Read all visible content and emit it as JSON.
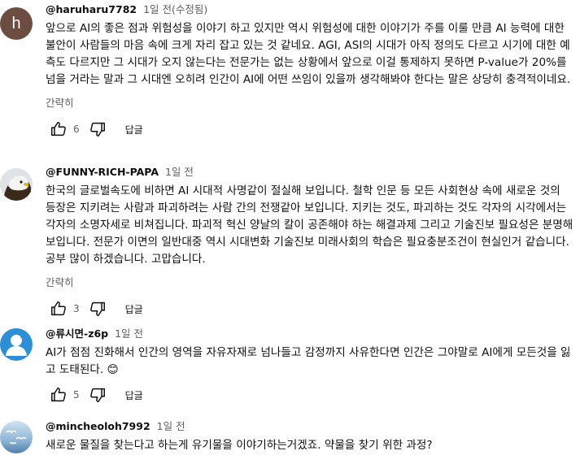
{
  "comments": [
    {
      "author": "@haruharu7782",
      "time": "1일 전(수정됨)",
      "avatar_letter": "h",
      "text": "앞으로 AI의 좋은 점과 위험성을 이야기 하고 있지만 역시 위험성에 대한 이야기가 주를 이룰 만큼 AI 능력에 대한 불안이 사람들의 마음 속에 크게 자리 잡고 있는 것 같네요. AGI, ASI의 시대가 아직 정의도 다르고 시기에 대한 예측도 다르지만 그 시대가 오지 않는다는 전문가는 없는 상황에서 앞으로 이걸 통제하지 못하면 P-value가 20%를 넘을 거라는 말과 그 시대엔 오히려 인간이 AI에 어떤 쓰임이 있을까 생각해봐야 한다는 말은 상당히 충격적이네요.",
      "more": "간략히",
      "likes": "6",
      "reply": "답글"
    },
    {
      "author": "@FUNNY-RICH-PAPA",
      "time": "1일 전",
      "text": "한국의 글로벌속도에 비하면 AI 시대적 사명같이 절실해 보입니다. 철학 인문 등 모든 사회현상 속에 새로운 것의 등장은 지키려는 사람과 파괴하려는 사람 간의 전쟁같아 보입니다. 지키는 것도, 파괴하는 것도 각자의 시각에서는 각자의 소명자세로 비쳐집니다. 파괴적 혁신 양날의 칼이 공존해야 하는 해결과제 그리고 기술진보 필요성은 분명해 보입니다. 전문가 이면의 일반대중 역시 시대변화 기술진보 미래사회의 학습은 필요충분조건이 현실인거 같습니다. 공부 많이 하겠습니다. 고맙습니다.",
      "more": "간략히",
      "likes": "3",
      "reply": "답글"
    },
    {
      "author": "@류시면-z6p",
      "time": "1일 전",
      "text": "AI가 점점 진화해서 인간의 영역을 자유자재로 넘나들고 감정까지 사유한다면 인간은 그야말로 AI에게 모든것을 잃고 도태된다. 😊",
      "likes": "5",
      "reply": "답글"
    },
    {
      "author": "@mincheoloh7992",
      "time": "1일 전",
      "text": "새로운 물질을 찾는다고 하는게 유기물을 이야기하는거겠죠. 약물을 찾기 위한 과정?"
    }
  ]
}
